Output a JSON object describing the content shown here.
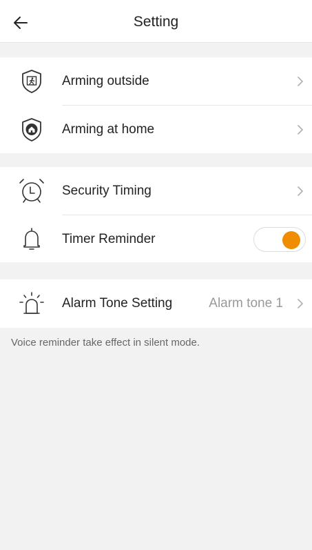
{
  "header": {
    "title": "Setting",
    "back_icon": "arrow-left-icon"
  },
  "group1": {
    "items": [
      {
        "label": "Arming outside",
        "icon": "shield-walking-person-icon"
      },
      {
        "label": "Arming at home",
        "icon": "shield-house-icon"
      }
    ]
  },
  "group2": {
    "items": [
      {
        "label": "Security Timing",
        "icon": "alarm-clock-icon"
      },
      {
        "label": "Timer Reminder",
        "icon": "bell-icon",
        "toggle_on": true
      }
    ]
  },
  "group3": {
    "items": [
      {
        "label": "Alarm Tone Setting",
        "value": "Alarm tone 1",
        "icon": "siren-icon"
      }
    ]
  },
  "note": "Voice reminder take effect in silent mode.",
  "colors": {
    "accent": "#f08c00",
    "background": "#f2f2f2",
    "divider": "#e6e6e6"
  }
}
